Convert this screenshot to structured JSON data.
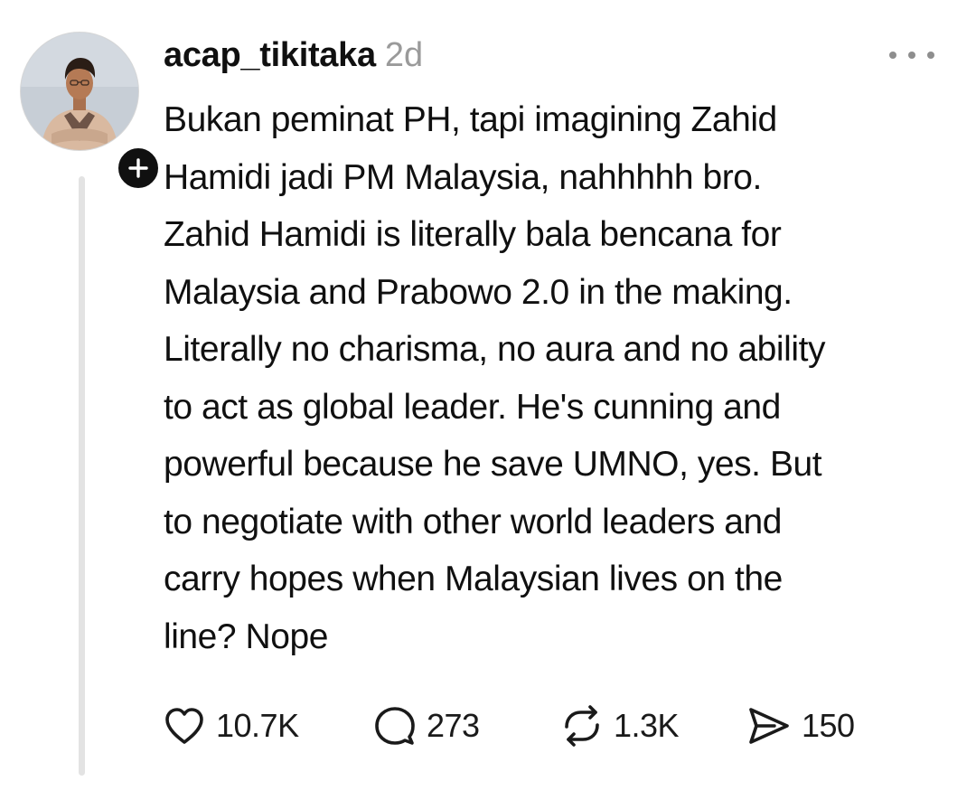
{
  "post": {
    "username": "acap_tikitaka",
    "timestamp": "2d",
    "text_lines": [
      "Bukan peminat PH, tapi imagining Zahid",
      "Hamidi jadi PM Malaysia, nahhhhh bro.",
      "Zahid Hamidi is literally bala bencana for",
      "Malaysia and Prabowo 2.0 in the making.",
      "Literally no charisma, no aura and no ability",
      "to act as global leader. He's cunning and",
      "powerful because he save UMNO, yes. But",
      "to negotiate with other world leaders and",
      "carry hopes when Malaysian lives on the",
      "line? Nope"
    ],
    "actions": {
      "likes": "10.7K",
      "comments": "273",
      "reposts": "1.3K",
      "shares": "150"
    }
  },
  "icons": {
    "avatar": "profile-photo",
    "follow": "plus-icon",
    "more": "more-horizontal-icon",
    "like": "heart-icon",
    "comment": "speech-bubble-icon",
    "repost": "repost-arrows-icon",
    "share": "paper-plane-icon"
  },
  "colors": {
    "text": "#101010",
    "muted": "#9a9a9a",
    "thread_line": "#e3e3e3",
    "badge": "#101010"
  }
}
